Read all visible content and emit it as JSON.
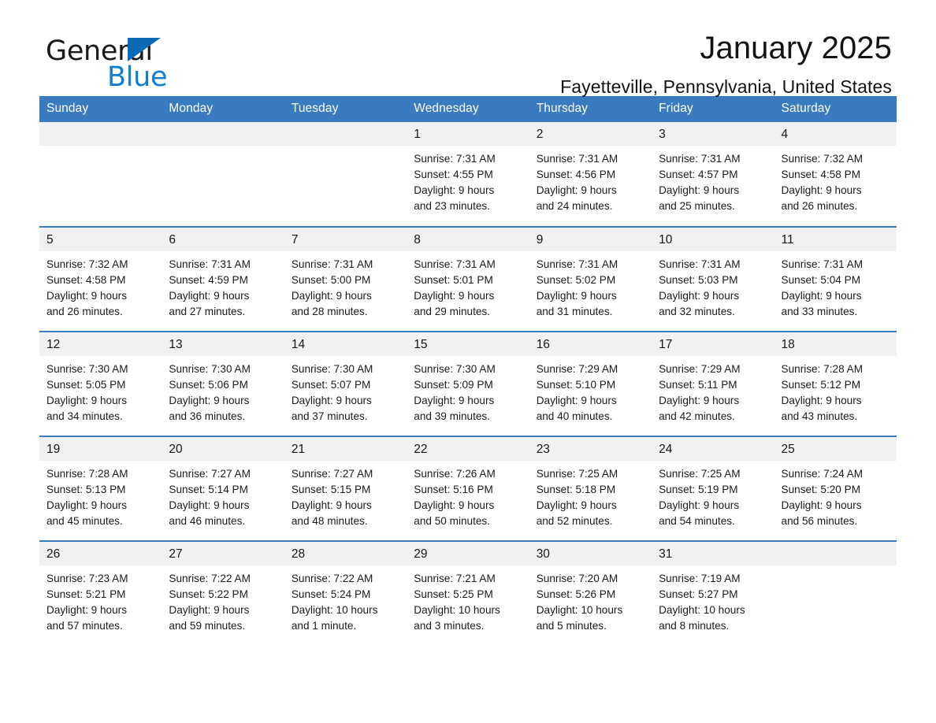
{
  "brand": {
    "word_one": "General",
    "word_two": "Blue",
    "triangle_color": "#0a6ab5",
    "blue_color": "#0f7fd4"
  },
  "header": {
    "title": "January 2025",
    "subtitle": "Fayetteville, Pennsylvania, United States"
  },
  "theme": {
    "header_blue": "#3a7bbf",
    "daynum_gray": "#f1f1f1",
    "text": "#1a1a1a"
  },
  "weekday_headers": [
    "Sunday",
    "Monday",
    "Tuesday",
    "Wednesday",
    "Thursday",
    "Friday",
    "Saturday"
  ],
  "weeks": [
    [
      {
        "day": "",
        "sunrise": "",
        "sunset": "",
        "daylight_line1": "",
        "daylight_line2": ""
      },
      {
        "day": "",
        "sunrise": "",
        "sunset": "",
        "daylight_line1": "",
        "daylight_line2": ""
      },
      {
        "day": "",
        "sunrise": "",
        "sunset": "",
        "daylight_line1": "",
        "daylight_line2": ""
      },
      {
        "day": "1",
        "sunrise": "Sunrise: 7:31 AM",
        "sunset": "Sunset: 4:55 PM",
        "daylight_line1": "Daylight: 9 hours",
        "daylight_line2": "and 23 minutes."
      },
      {
        "day": "2",
        "sunrise": "Sunrise: 7:31 AM",
        "sunset": "Sunset: 4:56 PM",
        "daylight_line1": "Daylight: 9 hours",
        "daylight_line2": "and 24 minutes."
      },
      {
        "day": "3",
        "sunrise": "Sunrise: 7:31 AM",
        "sunset": "Sunset: 4:57 PM",
        "daylight_line1": "Daylight: 9 hours",
        "daylight_line2": "and 25 minutes."
      },
      {
        "day": "4",
        "sunrise": "Sunrise: 7:32 AM",
        "sunset": "Sunset: 4:58 PM",
        "daylight_line1": "Daylight: 9 hours",
        "daylight_line2": "and 26 minutes."
      }
    ],
    [
      {
        "day": "5",
        "sunrise": "Sunrise: 7:32 AM",
        "sunset": "Sunset: 4:58 PM",
        "daylight_line1": "Daylight: 9 hours",
        "daylight_line2": "and 26 minutes."
      },
      {
        "day": "6",
        "sunrise": "Sunrise: 7:31 AM",
        "sunset": "Sunset: 4:59 PM",
        "daylight_line1": "Daylight: 9 hours",
        "daylight_line2": "and 27 minutes."
      },
      {
        "day": "7",
        "sunrise": "Sunrise: 7:31 AM",
        "sunset": "Sunset: 5:00 PM",
        "daylight_line1": "Daylight: 9 hours",
        "daylight_line2": "and 28 minutes."
      },
      {
        "day": "8",
        "sunrise": "Sunrise: 7:31 AM",
        "sunset": "Sunset: 5:01 PM",
        "daylight_line1": "Daylight: 9 hours",
        "daylight_line2": "and 29 minutes."
      },
      {
        "day": "9",
        "sunrise": "Sunrise: 7:31 AM",
        "sunset": "Sunset: 5:02 PM",
        "daylight_line1": "Daylight: 9 hours",
        "daylight_line2": "and 31 minutes."
      },
      {
        "day": "10",
        "sunrise": "Sunrise: 7:31 AM",
        "sunset": "Sunset: 5:03 PM",
        "daylight_line1": "Daylight: 9 hours",
        "daylight_line2": "and 32 minutes."
      },
      {
        "day": "11",
        "sunrise": "Sunrise: 7:31 AM",
        "sunset": "Sunset: 5:04 PM",
        "daylight_line1": "Daylight: 9 hours",
        "daylight_line2": "and 33 minutes."
      }
    ],
    [
      {
        "day": "12",
        "sunrise": "Sunrise: 7:30 AM",
        "sunset": "Sunset: 5:05 PM",
        "daylight_line1": "Daylight: 9 hours",
        "daylight_line2": "and 34 minutes."
      },
      {
        "day": "13",
        "sunrise": "Sunrise: 7:30 AM",
        "sunset": "Sunset: 5:06 PM",
        "daylight_line1": "Daylight: 9 hours",
        "daylight_line2": "and 36 minutes."
      },
      {
        "day": "14",
        "sunrise": "Sunrise: 7:30 AM",
        "sunset": "Sunset: 5:07 PM",
        "daylight_line1": "Daylight: 9 hours",
        "daylight_line2": "and 37 minutes."
      },
      {
        "day": "15",
        "sunrise": "Sunrise: 7:30 AM",
        "sunset": "Sunset: 5:09 PM",
        "daylight_line1": "Daylight: 9 hours",
        "daylight_line2": "and 39 minutes."
      },
      {
        "day": "16",
        "sunrise": "Sunrise: 7:29 AM",
        "sunset": "Sunset: 5:10 PM",
        "daylight_line1": "Daylight: 9 hours",
        "daylight_line2": "and 40 minutes."
      },
      {
        "day": "17",
        "sunrise": "Sunrise: 7:29 AM",
        "sunset": "Sunset: 5:11 PM",
        "daylight_line1": "Daylight: 9 hours",
        "daylight_line2": "and 42 minutes."
      },
      {
        "day": "18",
        "sunrise": "Sunrise: 7:28 AM",
        "sunset": "Sunset: 5:12 PM",
        "daylight_line1": "Daylight: 9 hours",
        "daylight_line2": "and 43 minutes."
      }
    ],
    [
      {
        "day": "19",
        "sunrise": "Sunrise: 7:28 AM",
        "sunset": "Sunset: 5:13 PM",
        "daylight_line1": "Daylight: 9 hours",
        "daylight_line2": "and 45 minutes."
      },
      {
        "day": "20",
        "sunrise": "Sunrise: 7:27 AM",
        "sunset": "Sunset: 5:14 PM",
        "daylight_line1": "Daylight: 9 hours",
        "daylight_line2": "and 46 minutes."
      },
      {
        "day": "21",
        "sunrise": "Sunrise: 7:27 AM",
        "sunset": "Sunset: 5:15 PM",
        "daylight_line1": "Daylight: 9 hours",
        "daylight_line2": "and 48 minutes."
      },
      {
        "day": "22",
        "sunrise": "Sunrise: 7:26 AM",
        "sunset": "Sunset: 5:16 PM",
        "daylight_line1": "Daylight: 9 hours",
        "daylight_line2": "and 50 minutes."
      },
      {
        "day": "23",
        "sunrise": "Sunrise: 7:25 AM",
        "sunset": "Sunset: 5:18 PM",
        "daylight_line1": "Daylight: 9 hours",
        "daylight_line2": "and 52 minutes."
      },
      {
        "day": "24",
        "sunrise": "Sunrise: 7:25 AM",
        "sunset": "Sunset: 5:19 PM",
        "daylight_line1": "Daylight: 9 hours",
        "daylight_line2": "and 54 minutes."
      },
      {
        "day": "25",
        "sunrise": "Sunrise: 7:24 AM",
        "sunset": "Sunset: 5:20 PM",
        "daylight_line1": "Daylight: 9 hours",
        "daylight_line2": "and 56 minutes."
      }
    ],
    [
      {
        "day": "26",
        "sunrise": "Sunrise: 7:23 AM",
        "sunset": "Sunset: 5:21 PM",
        "daylight_line1": "Daylight: 9 hours",
        "daylight_line2": "and 57 minutes."
      },
      {
        "day": "27",
        "sunrise": "Sunrise: 7:22 AM",
        "sunset": "Sunset: 5:22 PM",
        "daylight_line1": "Daylight: 9 hours",
        "daylight_line2": "and 59 minutes."
      },
      {
        "day": "28",
        "sunrise": "Sunrise: 7:22 AM",
        "sunset": "Sunset: 5:24 PM",
        "daylight_line1": "Daylight: 10 hours",
        "daylight_line2": "and 1 minute."
      },
      {
        "day": "29",
        "sunrise": "Sunrise: 7:21 AM",
        "sunset": "Sunset: 5:25 PM",
        "daylight_line1": "Daylight: 10 hours",
        "daylight_line2": "and 3 minutes."
      },
      {
        "day": "30",
        "sunrise": "Sunrise: 7:20 AM",
        "sunset": "Sunset: 5:26 PM",
        "daylight_line1": "Daylight: 10 hours",
        "daylight_line2": "and 5 minutes."
      },
      {
        "day": "31",
        "sunrise": "Sunrise: 7:19 AM",
        "sunset": "Sunset: 5:27 PM",
        "daylight_line1": "Daylight: 10 hours",
        "daylight_line2": "and 8 minutes."
      },
      {
        "day": "",
        "sunrise": "",
        "sunset": "",
        "daylight_line1": "",
        "daylight_line2": ""
      }
    ]
  ]
}
